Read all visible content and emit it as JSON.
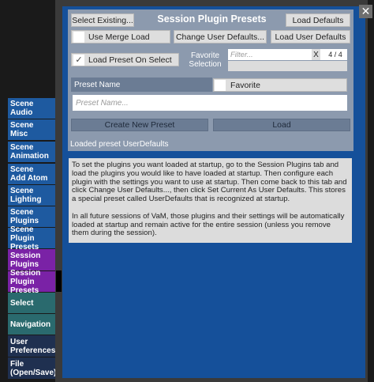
{
  "side_tabs": [
    {
      "label": "Scene Audio",
      "lines": [
        "Scene",
        "Audio"
      ],
      "style": "tab-blue",
      "active": false
    },
    {
      "label": "Scene Misc",
      "lines": [
        "Scene",
        "Misc"
      ],
      "style": "tab-blue",
      "active": false
    },
    {
      "label": "Scene Animation",
      "lines": [
        "Scene",
        "Animation"
      ],
      "style": "tab-blue",
      "active": false
    },
    {
      "label": "Scene Add Atom",
      "lines": [
        "Scene",
        "Add Atom"
      ],
      "style": "tab-blue",
      "active": false
    },
    {
      "label": "Scene Lighting",
      "lines": [
        "Scene",
        "Lighting"
      ],
      "style": "tab-blue",
      "active": false
    },
    {
      "label": "Scene Plugins",
      "lines": [
        "Scene",
        "Plugins"
      ],
      "style": "tab-blue",
      "active": false
    },
    {
      "label": "Scene Plugin Presets",
      "lines": [
        "Scene Plugin",
        "Presets"
      ],
      "style": "tab-blue",
      "active": false
    },
    {
      "label": "Session Plugins",
      "lines": [
        "Session",
        "Plugins"
      ],
      "style": "tab-purple",
      "active": false
    },
    {
      "label": "Session Plugin Presets",
      "lines": [
        "Session Plugin",
        "Presets"
      ],
      "style": "tab-purple",
      "active": true
    },
    {
      "label": "Select",
      "lines": [
        "Select"
      ],
      "style": "tab-teal",
      "active": false
    },
    {
      "label": "Navigation",
      "lines": [
        "Navigation"
      ],
      "style": "tab-teal",
      "active": false
    },
    {
      "label": "User Preferences",
      "lines": [
        "User",
        "Preferences"
      ],
      "style": "tab-navy",
      "active": false
    },
    {
      "label": "File (Open/Save)",
      "lines": [
        "File",
        "(Open/Save)"
      ],
      "style": "tab-navy",
      "active": false
    }
  ],
  "panel": {
    "title": "Session Plugin Presets",
    "select_existing": "Select Existing...",
    "load_defaults": "Load Defaults",
    "use_merge_load": "Use Merge Load",
    "use_merge_load_checked": false,
    "change_user_defaults": "Change User Defaults...",
    "load_user_defaults": "Load User Defaults",
    "load_preset_on_select": "Load Preset On Select",
    "load_preset_on_select_checked": true,
    "favorite_selection_line1": "Favorite",
    "favorite_selection_line2": "Selection",
    "filter_placeholder": "Filter...",
    "filter_clear": "X",
    "filter_count": "4 / 4",
    "preset_name_label": "Preset Name",
    "favorite_label": "Favorite",
    "favorite_checked": false,
    "preset_name_placeholder": "Preset Name...",
    "create_new_preset": "Create New Preset",
    "load": "Load",
    "status": "Loaded preset UserDefaults"
  },
  "help": {
    "paragraph1": "To set the plugins you want loaded at startup, go to the Session Plugins tab and load the plugins you would like to have loaded at startup. Then configure each plugin with the settings you want to use at startup. Then come back to this tab and click Change User Defaults..., then click Set Current As User Defaults. This stores a special preset called UserDefaults that is recognized at startup.",
    "paragraph2": "In all future sessions of VaM, those plugins and their settings will be automatically loaded at startup and remain active for the entire session (unless you remove them during the session)."
  },
  "colors": {
    "tab_blue": "#1e5aa0",
    "tab_purple": "#7a22a6",
    "tab_teal": "#2a6a6e",
    "tab_navy": "#1f3050",
    "panel_bg": "#15509a",
    "preset_panel_bg": "#8c9aae"
  },
  "icons": {
    "close": "close-icon",
    "checkmark": "checkmark-icon"
  }
}
